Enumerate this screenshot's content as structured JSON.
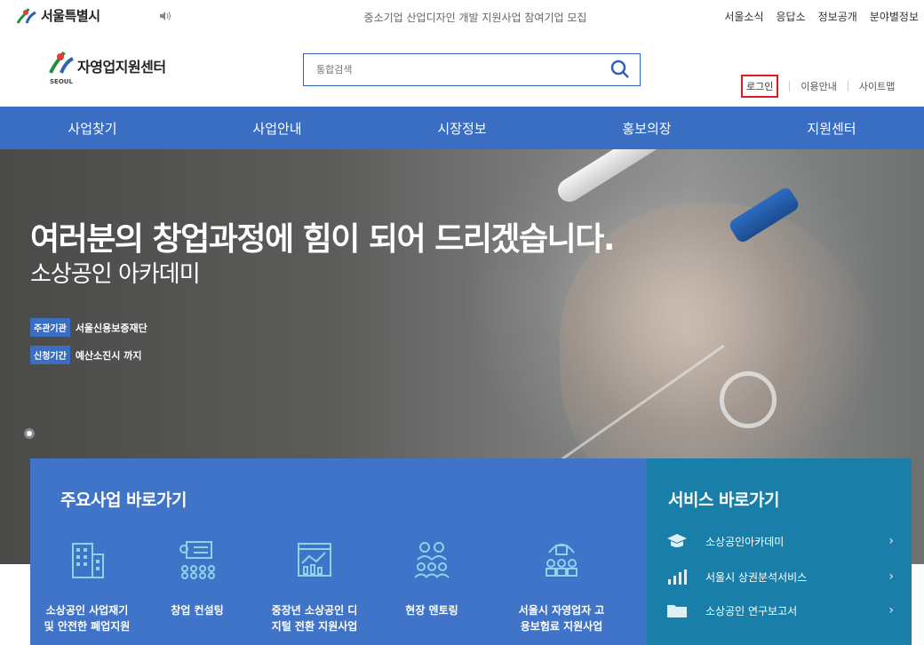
{
  "topbar": {
    "logo_text": "서울특별시",
    "notice": "중소기업 산업디자인 개발 지원사업 참여기업 모집",
    "links": [
      "서울소식",
      "응답소",
      "정보공개",
      "분야별정보"
    ]
  },
  "header": {
    "logo_name": "자영업지원센터",
    "logo_sub": "SEOUL",
    "search_placeholder": "통합검색",
    "login": "로그인",
    "guide": "이용안내",
    "sitemap": "사이트맵"
  },
  "nav": [
    "사업찾기",
    "사업안내",
    "시장정보",
    "홍보의장",
    "지원센터"
  ],
  "hero": {
    "title": "여러분의 창업과정에 힘이 되어 드리겠습니다.",
    "subtitle": "소상공인 아카데미",
    "host_tag": "주관기관",
    "host_value": "서울신용보증재단",
    "period_tag": "신청기간",
    "period_value": "예산소진시 까지"
  },
  "quick": {
    "title": "주요사업 바로가기",
    "items": [
      {
        "line1": "소상공인 사업재기",
        "line2": "및 안전한 폐업지원",
        "icon": "building-icon"
      },
      {
        "line1": "창업 컨설팅",
        "line2": "",
        "icon": "presentation-icon"
      },
      {
        "line1": "중장년 소상공인 디",
        "line2": "지털 전환 지원사업",
        "icon": "digital-chart-icon"
      },
      {
        "line1": "현장 멘토링",
        "line2": "",
        "icon": "mentoring-icon"
      },
      {
        "line1": "서울시 자영업자 고",
        "line2": "용보험료 지원사업",
        "icon": "insurance-people-icon"
      }
    ]
  },
  "service": {
    "title": "서비스 바로가기",
    "items": [
      {
        "label": "소상공인아카데미",
        "icon": "graduation-cap-icon"
      },
      {
        "label": "서울시 상권분석서비스",
        "icon": "bar-chart-icon"
      },
      {
        "label": "소상공인 연구보고서",
        "icon": "folder-icon"
      }
    ],
    "arrow": "›"
  },
  "colors": {
    "nav_blue": "#3a6ec3",
    "service_teal": "#1a7fa8",
    "login_highlight": "#e21a1a"
  }
}
